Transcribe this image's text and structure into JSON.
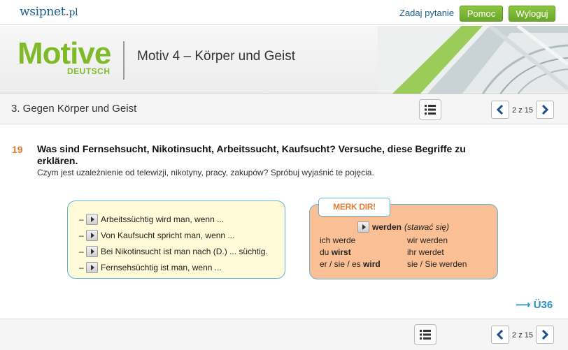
{
  "topbar": {
    "brand": "wsipnet",
    "brand_dot": ".",
    "brand_tld": "pl",
    "ask_link": "Zadaj pytanie",
    "help_button": "Pomoc",
    "logout_button": "Wyloguj"
  },
  "banner": {
    "logo_main": "Motive",
    "logo_sub": "DEUTSCH",
    "title": "Motiv 4 – Körper und Geist"
  },
  "section": {
    "title": "3. Gegen Körper und Geist",
    "page_indicator": "2 z 15"
  },
  "exercise": {
    "number": "19",
    "question": "Was sind Fernsehsucht, Nikotinsucht, Arbeitssucht, Kaufsucht? Versuche, diese Begriffe zu erklären.",
    "subtitle": "Czym jest uzależnienie od telewizji, nikotyny, pracy, zakupów? Spróbuj wyjaśnić te pojęcia.",
    "items": [
      {
        "dash": "–",
        "text": "Arbeitssüchtig wird man, wenn ..."
      },
      {
        "dash": "–",
        "text": "Von Kaufsucht spricht man, wenn ..."
      },
      {
        "dash": "–",
        "text": "Bei Nikotinsucht ist man nach (D.) ... süchtig."
      },
      {
        "dash": "–",
        "text": "Fernsehsüchtig ist man, wenn ..."
      }
    ]
  },
  "merkdir": {
    "label": "MERK DIR!",
    "verb": "werden",
    "verb_translation": "(stawać się)",
    "rows": [
      {
        "left_pre": "ich werde",
        "left_bold": "",
        "right": "wir werden"
      },
      {
        "left_pre": "du ",
        "left_bold": "wirst",
        "right": "ihr werdet"
      },
      {
        "left_pre": "er / sie / es ",
        "left_bold": "wird",
        "right": "sie / Sie werden"
      }
    ]
  },
  "link": {
    "arrow": "⟶",
    "text": "Ü36"
  },
  "bottom": {
    "page_indicator": "2 z 15"
  },
  "colors": {
    "accent_green": "#7fba2a",
    "brand_blue": "#1c5f8c",
    "exercise_orange": "#d97c2a",
    "box_border": "#5fb4d9"
  }
}
